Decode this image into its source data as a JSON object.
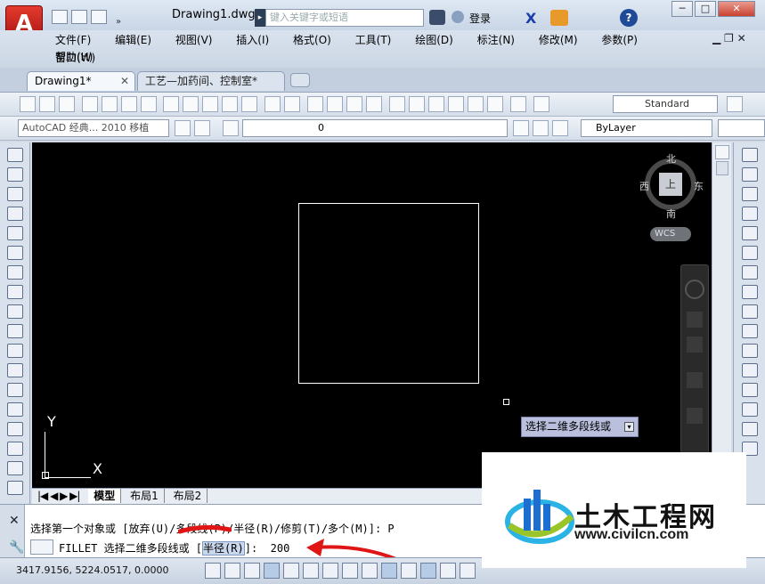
{
  "app": {
    "logo_letter": "A",
    "doc_title": "Drawing1.dwg",
    "search_placeholder": "键入关键字或短语",
    "login_label": "登录"
  },
  "menu": [
    "文件(F)",
    "编辑(E)",
    "视图(V)",
    "插入(I)",
    "格式(O)",
    "工具(T)",
    "绘图(D)",
    "标注(N)",
    "修改(M)",
    "参数(P)",
    "窗口(W)",
    "帮助(H)"
  ],
  "tabs": [
    {
      "label": "Drawing1*"
    },
    {
      "label": "工艺—加药间、控制室*"
    }
  ],
  "toolbar": {
    "text_style": "Standard",
    "workspace": "AutoCAD 经典... 2010 移植",
    "layer": "0",
    "linetype": "ByLayer"
  },
  "viewcube": {
    "north": "北",
    "south": "南",
    "west": "西",
    "east": "东",
    "center": "上",
    "wcs": "WCS"
  },
  "ucs": {
    "x": "X",
    "y": "Y"
  },
  "tooltip": "选择二维多段线或",
  "layout_tabs": [
    "模型",
    "布局1",
    "布局2"
  ],
  "command": {
    "line1": "选择第一个对象或 [放弃(U)/多段线(P)/半径(R)/修剪(T)/多个(M)]: P",
    "prompt_prefix": "FILLET 选择二维多段线或 [",
    "prompt_opt": "半径(R)",
    "prompt_suffix": "]:  200"
  },
  "status": {
    "coords": "3417.9156, 5224.0517, 0.0000"
  },
  "watermark": {
    "title": "土木工程网",
    "url": "www.civilcn.com"
  },
  "colors": {
    "accent_red": "#d31d16",
    "canvas": "#000000",
    "annotation_red": "#e01515"
  }
}
